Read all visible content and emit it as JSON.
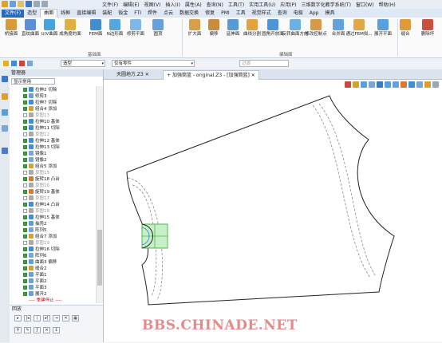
{
  "menu": [
    "文件(F)",
    "编辑(E)",
    "视图(V)",
    "插入(I)",
    "属性(A)",
    "查询(N)",
    "工具(T)",
    "实用工具(U)",
    "应用(P)",
    "三维数字化教学系统(T)",
    "窗口(W)",
    "帮助(H)"
  ],
  "tabs": [
    "文件(F)",
    "造型",
    "曲面",
    "线框",
    "直接编辑",
    "装配",
    "钣金",
    "FTI",
    "焊件",
    "点云",
    "数据交换",
    "修复",
    "PMI",
    "工具",
    "视觉样式",
    "查询",
    "电极",
    "App",
    "模具"
  ],
  "active_tab": "曲面",
  "ribbon": {
    "groups": [
      "基础面",
      "编辑面"
    ],
    "buttons": [
      {
        "label": "桥接面",
        "color": "#d99a3a"
      },
      {
        "label": "直纹曲面",
        "color": "#5b8ed6"
      },
      {
        "label": "U/V曲面",
        "color": "#4aa3d8"
      },
      {
        "label": "成角度的面",
        "color": "#e0b03c"
      },
      {
        "label": "FEM面",
        "color": "#3f8fd2"
      },
      {
        "label": "N边形面",
        "color": "#58a6e0"
      },
      {
        "label": "修剪平面",
        "color": "#7fb8e8"
      },
      {
        "label": "圆顶",
        "color": "#6aa0d8"
      },
      {
        "label": "扩大面",
        "color": "#d6a04a"
      },
      {
        "label": "偏移",
        "color": "#c98c3c"
      },
      {
        "label": "延伸面",
        "color": "#5a9ad4"
      },
      {
        "label": "曲线分割",
        "color": "#e2a23e"
      },
      {
        "label": "圆角开放面",
        "color": "#4c95d6"
      },
      {
        "label": "反转曲面方向",
        "color": "#6cb0e4"
      },
      {
        "label": "修改控制点",
        "color": "#d89a48"
      },
      {
        "label": "合并面",
        "color": "#5fa2dc"
      },
      {
        "label": "通过FEM拟...",
        "color": "#e0a848"
      },
      {
        "label": "展开平面",
        "color": "#58a0dc"
      },
      {
        "label": "缝合",
        "color": "#e09a3c"
      },
      {
        "label": "删除坏",
        "color": "#c8503c"
      }
    ]
  },
  "toolbar": {
    "mode_select": "造型",
    "filter_select": "仅有零件",
    "search_placeholder": "过滤"
  },
  "manager": {
    "title": "管理器",
    "filter": "显示常用",
    "tree": [
      {
        "label": "拉伸2 切除",
        "dim": false,
        "color": "#3c8fd8"
      },
      {
        "label": "修剪3",
        "dim": false,
        "color": "#6a9fd8"
      },
      {
        "label": "拉伸7 切除",
        "dim": false,
        "color": "#3c8fd8"
      },
      {
        "label": "组合4 添加",
        "dim": false,
        "color": "#d8a030"
      },
      {
        "label": "草图13",
        "dim": true,
        "color": "#aaaaaa"
      },
      {
        "label": "拉伸10 基体",
        "dim": false,
        "color": "#3c8fd8"
      },
      {
        "label": "拉伸11 切除",
        "dim": false,
        "color": "#3c8fd8"
      },
      {
        "label": "草图12",
        "dim": true,
        "color": "#aaaaaa"
      },
      {
        "label": "拉伸12 基体",
        "dim": false,
        "color": "#3c8fd8"
      },
      {
        "label": "拉伸13 切除",
        "dim": false,
        "color": "#3c8fd8"
      },
      {
        "label": "镜像1",
        "dim": false,
        "color": "#7aa6d6"
      },
      {
        "label": "镜像2",
        "dim": false,
        "color": "#7aa6d6"
      },
      {
        "label": "组合5 添加",
        "dim": false,
        "color": "#d8a030"
      },
      {
        "label": "草图15",
        "dim": true,
        "color": "#aaaaaa"
      },
      {
        "label": "旋转18 凸台",
        "dim": false,
        "color": "#d87a30"
      },
      {
        "label": "草图16",
        "dim": true,
        "color": "#aaaaaa"
      },
      {
        "label": "旋转19 基体",
        "dim": false,
        "color": "#d87a30"
      },
      {
        "label": "草图17",
        "dim": true,
        "color": "#aaaaaa"
      },
      {
        "label": "拉伸14 凸台",
        "dim": false,
        "color": "#3c8fd8"
      },
      {
        "label": "草图18",
        "dim": true,
        "color": "#aaaaaa"
      },
      {
        "label": "拉伸15 基体",
        "dim": false,
        "color": "#3c8fd8"
      },
      {
        "label": "抽壳2",
        "dim": false,
        "color": "#5aa0d8"
      },
      {
        "label": "阵列5",
        "dim": false,
        "color": "#7aa6d6"
      },
      {
        "label": "组合7 添加",
        "dim": false,
        "color": "#d8a030"
      },
      {
        "label": "草图19",
        "dim": true,
        "color": "#aaaaaa"
      },
      {
        "label": "拉伸16 切除",
        "dim": false,
        "color": "#3c8fd8"
      },
      {
        "label": "阵列6",
        "dim": false,
        "color": "#7aa6d6"
      },
      {
        "label": "曲面3 偏移",
        "dim": false,
        "color": "#5aa0d8"
      },
      {
        "label": "缝合2",
        "dim": false,
        "color": "#d8a030"
      },
      {
        "label": "平面1",
        "dim": false,
        "color": "#6a9fd8"
      },
      {
        "label": "平面2",
        "dim": false,
        "color": "#6a9fd8"
      },
      {
        "label": "平面3",
        "dim": false,
        "color": "#6a9fd8"
      },
      {
        "label": "展开2",
        "dim": false,
        "color": "#6a9fd8"
      }
    ],
    "rebuild_stop": "---- 重建停止 ----",
    "section_title": "回放"
  },
  "doc_tabs": [
    "天圆地方.Z3",
    "加强筒篮 - original.Z3 - [加强筒篮]"
  ],
  "watermark": "BBS.CHINADE.NET"
}
